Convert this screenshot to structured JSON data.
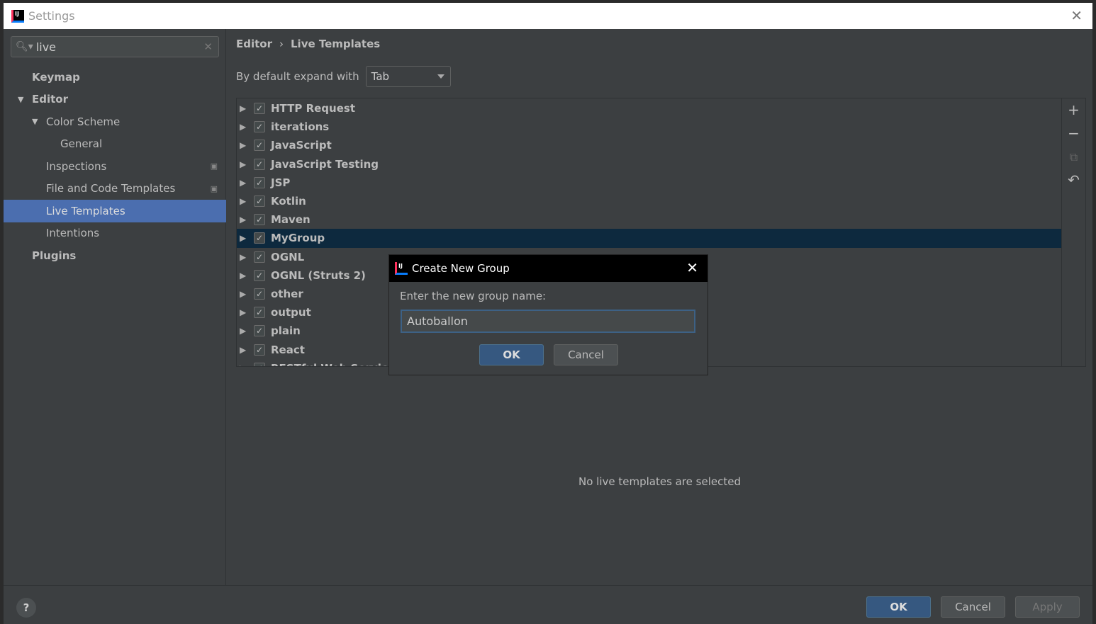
{
  "window": {
    "title": "Settings"
  },
  "search": {
    "value": "live"
  },
  "sidebar": {
    "items": [
      {
        "label": "Keymap",
        "bold": true,
        "level": 0,
        "arrow": ""
      },
      {
        "label": "Editor",
        "bold": true,
        "level": 0,
        "arrow": "▼"
      },
      {
        "label": "Color Scheme",
        "bold": false,
        "level": 1,
        "arrow": "▼"
      },
      {
        "label": "General",
        "bold": false,
        "level": 2,
        "arrow": ""
      },
      {
        "label": "Inspections",
        "bold": false,
        "level": 1,
        "arrow": "",
        "copy": true
      },
      {
        "label": "File and Code Templates",
        "bold": false,
        "level": 1,
        "arrow": "",
        "copy": true
      },
      {
        "label": "Live Templates",
        "bold": false,
        "level": 1,
        "arrow": "",
        "selected": true
      },
      {
        "label": "Intentions",
        "bold": false,
        "level": 1,
        "arrow": ""
      },
      {
        "label": "Plugins",
        "bold": true,
        "level": 0,
        "arrow": ""
      }
    ]
  },
  "breadcrumb": {
    "parent": "Editor",
    "current": "Live Templates",
    "sep": "›"
  },
  "expand": {
    "label": "By default expand with",
    "value": "Tab"
  },
  "groups": [
    {
      "label": "HTTP Request"
    },
    {
      "label": "iterations"
    },
    {
      "label": "JavaScript"
    },
    {
      "label": "JavaScript Testing"
    },
    {
      "label": "JSP"
    },
    {
      "label": "Kotlin"
    },
    {
      "label": "Maven"
    },
    {
      "label": "MyGroup",
      "selected": true
    },
    {
      "label": "OGNL"
    },
    {
      "label": "OGNL (Struts 2)"
    },
    {
      "label": "other"
    },
    {
      "label": "output"
    },
    {
      "label": "plain"
    },
    {
      "label": "React"
    },
    {
      "label": "RESTful Web Services"
    }
  ],
  "tools": {
    "add": "+",
    "remove": "−",
    "copy": "⧉",
    "revert": "↶"
  },
  "empty_message": "No live templates are selected",
  "buttons": {
    "help": "?",
    "ok": "OK",
    "cancel": "Cancel",
    "apply": "Apply"
  },
  "dialog": {
    "title": "Create New Group",
    "label": "Enter the new group name:",
    "value": "Autoballon",
    "ok": "OK",
    "cancel": "Cancel"
  },
  "colors": {
    "selection": "#4b6eaf",
    "row_selection": "#0d293e",
    "primary_button": "#365880"
  }
}
